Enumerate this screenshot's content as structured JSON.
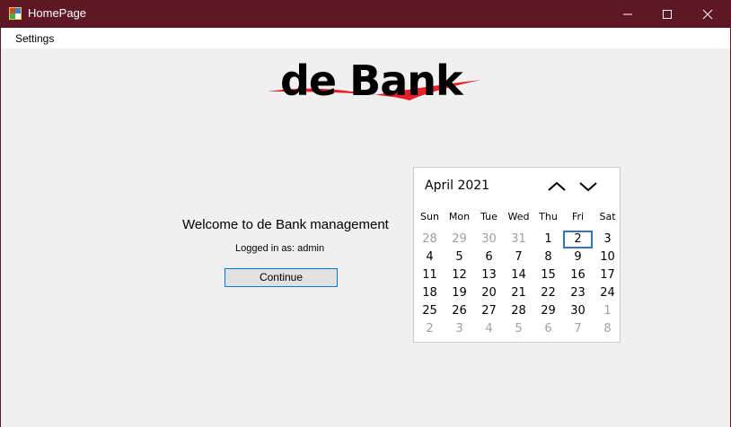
{
  "window": {
    "title": "HomePage",
    "accent_color": "#5e1724"
  },
  "menu": {
    "items": [
      "Settings"
    ]
  },
  "logo": {
    "text": "de Bank",
    "swoosh_color": "#e8202a"
  },
  "main": {
    "welcome": "Welcome to de Bank management",
    "logged_in": "Logged in as: admin",
    "continue_label": "Continue"
  },
  "calendar": {
    "month_year": "April  2021",
    "days_of_week": [
      "Sun",
      "Mon",
      "Tue",
      "Wed",
      "Thu",
      "Fri",
      "Sat"
    ],
    "weeks": [
      [
        "28",
        "29",
        "30",
        "31",
        "1",
        "2",
        "3"
      ],
      [
        "4",
        "5",
        "6",
        "7",
        "8",
        "9",
        "10"
      ],
      [
        "11",
        "12",
        "13",
        "14",
        "15",
        "16",
        "17"
      ],
      [
        "18",
        "19",
        "20",
        "21",
        "22",
        "23",
        "24"
      ],
      [
        "25",
        "26",
        "27",
        "28",
        "29",
        "30",
        "1"
      ],
      [
        "2",
        "3",
        "4",
        "5",
        "6",
        "7",
        "8"
      ]
    ],
    "today": "2",
    "selected_color": "#3275b8"
  }
}
